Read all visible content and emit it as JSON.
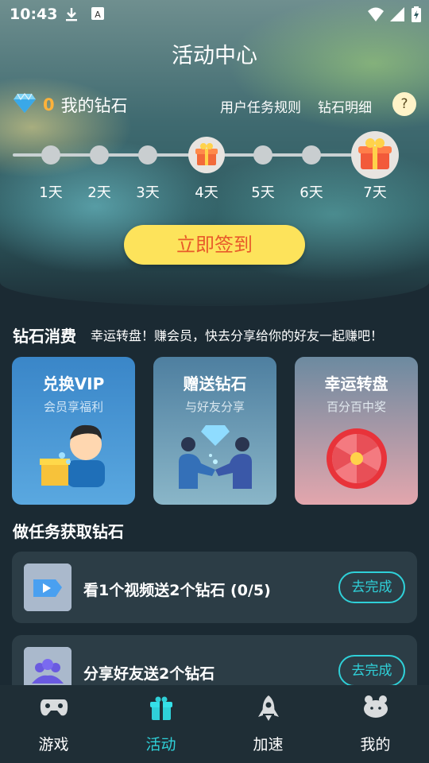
{
  "status": {
    "time": "10:43"
  },
  "header": {
    "title": "活动中心"
  },
  "diamonds": {
    "count": "0",
    "label": "我的钻石",
    "rules_link": "用户任务规则",
    "detail_link": "钻石明细",
    "help_label": "?"
  },
  "checkin": {
    "days": [
      "1天",
      "2天",
      "3天",
      "4天",
      "5天",
      "6天",
      "7天"
    ],
    "button": "立即签到"
  },
  "consume": {
    "title": "钻石消费",
    "subtitle": "幸运转盘！赚会员，快去分享给你的好友一起赚吧！",
    "cards": [
      {
        "title": "兑换VIP",
        "subtitle": "会员享福利"
      },
      {
        "title": "赠送钻石",
        "subtitle": "与好友分享"
      },
      {
        "title": "幸运转盘",
        "subtitle": "百分百中奖"
      }
    ]
  },
  "tasks": {
    "title": "做任务获取钻石",
    "items": [
      {
        "title": "看1个视频送2个钻石 (0/5)",
        "button": "去完成"
      },
      {
        "title": "分享好友送2个钻石",
        "button": "去完成"
      }
    ]
  },
  "nav": {
    "items": [
      {
        "label": "游戏"
      },
      {
        "label": "活动"
      },
      {
        "label": "加速"
      },
      {
        "label": "我的"
      }
    ],
    "active_color": "#2fd0d8"
  }
}
